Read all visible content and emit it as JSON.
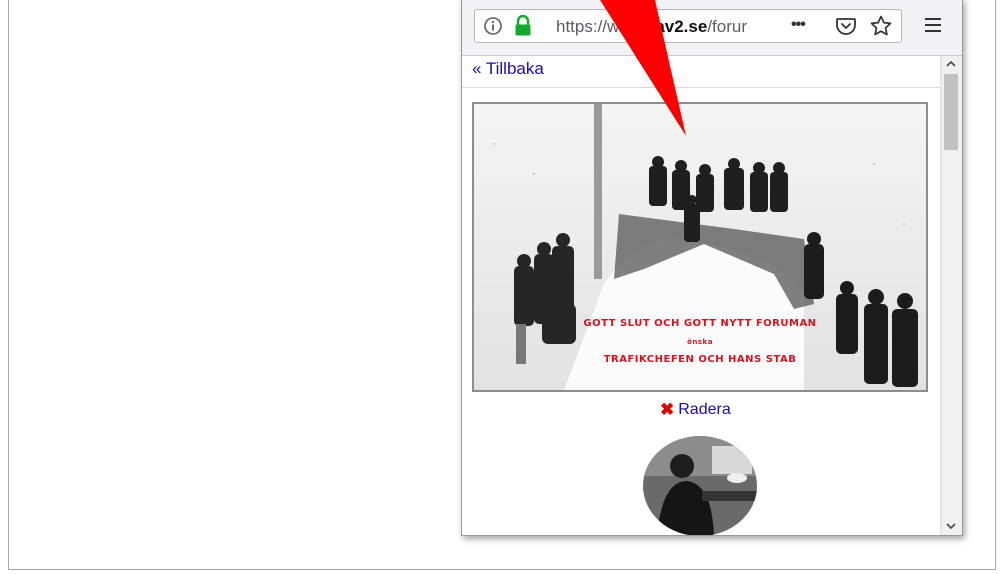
{
  "browser": {
    "url_prefix": "https://w",
    "url_domain": "av2.se",
    "url_suffix": "/forur",
    "more_label": "•••",
    "menu_label": "≡"
  },
  "content": {
    "back_link": "« Tillbaka",
    "photo_caption": {
      "line1": "GOTT SLUT OCH GOTT NYTT FORUMAN",
      "line2": "önska",
      "line3": "TRAFIKCHEFEN OCH HANS STAB"
    },
    "delete_label": "Radera"
  },
  "colors": {
    "link": "#1a0dab",
    "delete_x": "#e00000",
    "arrow": "#ff0000",
    "lock": "#12a82b"
  },
  "icons": {
    "info": "info-icon",
    "lock": "lock-icon",
    "pocket": "pocket-icon",
    "star": "star-icon",
    "menu": "hamburger-menu-icon"
  }
}
